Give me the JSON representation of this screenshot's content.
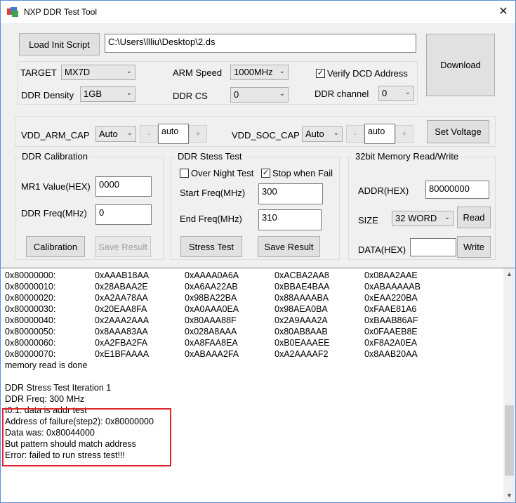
{
  "window": {
    "title": "NXP DDR Test Tool",
    "close_glyph": "✕"
  },
  "toolbar": {
    "load_init_script_label": "Load Init Script",
    "script_path": "C:\\Users\\llliu\\Desktop\\2.ds",
    "download_label": "Download"
  },
  "config": {
    "target_label": "TARGET",
    "target_value": "MX7D",
    "arm_speed_label": "ARM Speed",
    "arm_speed_value": "1000MHz",
    "verify_dcd_label": "Verify DCD Address",
    "verify_dcd_checked": true,
    "ddr_density_label": "DDR Density",
    "ddr_density_value": "1GB",
    "ddr_cs_label": "DDR CS",
    "ddr_cs_value": "0",
    "ddr_channel_label": "DDR channel",
    "ddr_channel_value": "0"
  },
  "voltage": {
    "vdd_arm_label": "VDD_ARM_CAP",
    "vdd_arm_mode": "Auto",
    "vdd_arm_value": "auto",
    "vdd_soc_label": "VDD_SOC_CAP",
    "vdd_soc_mode": "Auto",
    "vdd_soc_value": "auto",
    "minus": "-",
    "plus": "+",
    "set_voltage_label": "Set Voltage"
  },
  "calibration": {
    "title": "DDR Calibration",
    "mr1_label": "MR1 Value(HEX)",
    "mr1_value": "0000",
    "freq_label": "DDR Freq(MHz)",
    "freq_value": "0",
    "calibration_button": "Calibration",
    "save_result_button": "Save Result"
  },
  "stress": {
    "title": "DDR Stess Test",
    "over_night_label": "Over Night Test",
    "over_night_checked": false,
    "stop_when_fail_label": "Stop when Fail",
    "stop_when_fail_checked": true,
    "start_freq_label": "Start Freq(MHz)",
    "start_freq_value": "300",
    "end_freq_label": "End Freq(MHz)",
    "end_freq_value": "310",
    "stress_test_button": "Stress Test",
    "save_result_button": "Save Result"
  },
  "memory": {
    "title": "32bit Memory Read/Write",
    "addr_label": "ADDR(HEX)",
    "addr_value": "80000000",
    "size_label": "SIZE",
    "size_value": "32 WORD",
    "read_button": "Read",
    "data_label": "DATA(HEX)",
    "data_value": "",
    "write_button": "Write"
  },
  "log": {
    "dump_rows": [
      [
        "0x80000000:",
        "0xAAAB18AA",
        "0xAAAA0A6A",
        "0xACBA2AA8",
        "0x08AA2AAE"
      ],
      [
        "0x80000010:",
        "0x28ABAA2E",
        "0xA6AA22AB",
        "0xBBAE4BAA",
        "0xABAAAAAB"
      ],
      [
        "0x80000020:",
        "0xA2AA78AA",
        "0x98BA22BA",
        "0x88AAAABA",
        "0xEAA220BA"
      ],
      [
        "0x80000030:",
        "0x20EAA8FA",
        "0xA0AAA0EA",
        "0x98AEA0BA",
        "0xFAAE81A6"
      ],
      [
        "0x80000040:",
        "0x2AAA2AAA",
        "0x80AAA88F",
        "0x2A9AAA2A",
        "0xBAAB86AF"
      ],
      [
        "0x80000050:",
        "0x8AAA83AA",
        "0x028A8AAA",
        "0x80AB8AAB",
        "0x0FAAEB8E"
      ],
      [
        "0x80000060:",
        "0xA2FBA2FA",
        "0xA8FAA8EA",
        "0xB0EAAAEE",
        "0xF8A2A0EA"
      ],
      [
        "0x80000070:",
        "0xE1BFAAAA",
        "0xABAAA2FA",
        "0xA2AAAAF2",
        "0x8AAB20AA"
      ]
    ],
    "lines": [
      "memory read is done",
      "",
      "DDR Stress Test Iteration 1",
      "DDR Freq: 300 MHz",
      "t0.1: data is addr test",
      "Address of failure(step2): 0x80000000",
      "Data was: 0x80044000",
      "But pattern  should match address",
      "Error: failed to run stress test!!!"
    ]
  }
}
